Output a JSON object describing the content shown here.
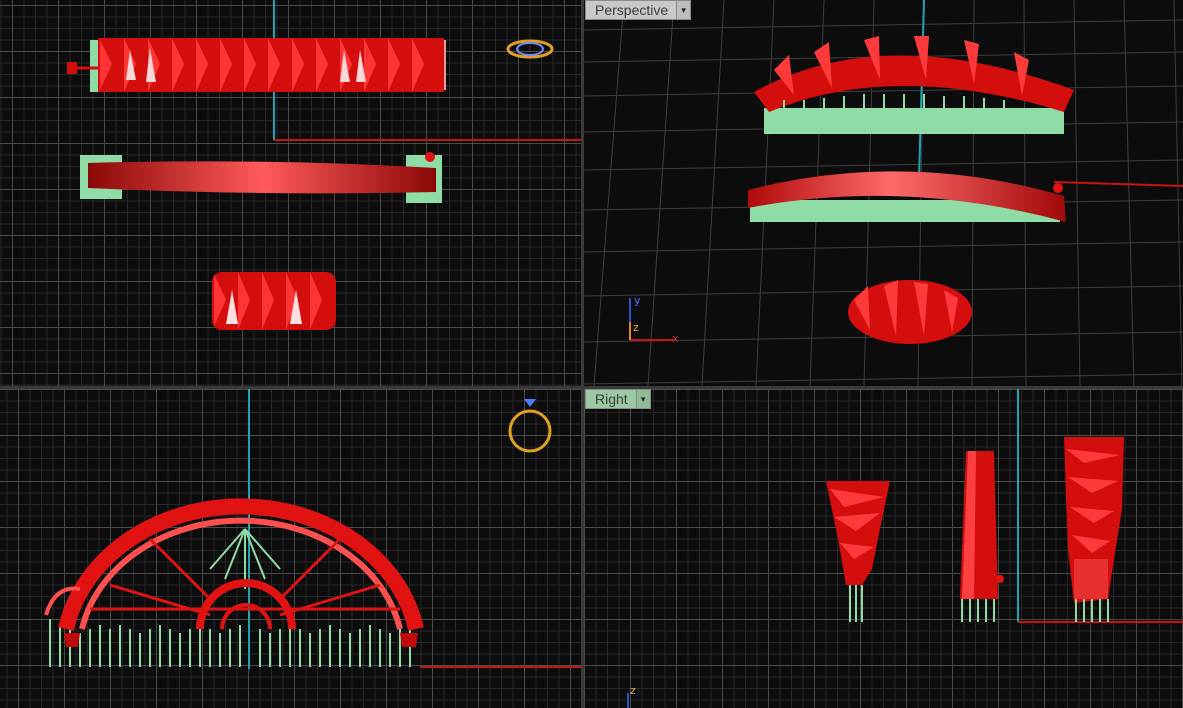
{
  "viewports": {
    "top": {
      "label": ""
    },
    "perspective": {
      "label": "Perspective",
      "dropdown": "▾"
    },
    "front": {
      "label": ""
    },
    "right": {
      "label": "Right",
      "dropdown": "▾"
    }
  },
  "axes": {
    "perspective": {
      "y": "y",
      "z": "z",
      "x": "x"
    },
    "right": {
      "z": "z"
    }
  },
  "icons": [
    "ring-view-icon",
    "ring-front-icon",
    "dropdown-arrow-icon",
    "axis-gizmo-icon"
  ],
  "colors": {
    "viewport_bg": "#0c0c0c",
    "grid_major": "#4a4a4a",
    "grid_minor": "#262626",
    "model_red": "#e11212",
    "support_green": "#8fdca6",
    "axis_cyan": "#1fa5b4",
    "axis_red": "#c81414"
  }
}
